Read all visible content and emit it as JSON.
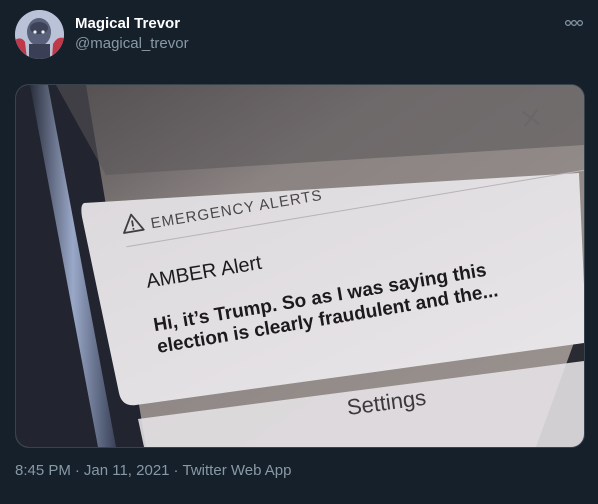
{
  "tweet": {
    "display_name": "Magical Trevor",
    "handle": "@magical_trevor",
    "time": "8:45 PM",
    "separator": "·",
    "date": "Jan 11, 2021",
    "source": "Twitter Web App"
  },
  "media": {
    "alert": {
      "header": "EMERGENCY ALERTS",
      "title": "AMBER Alert",
      "line1": "Hi, it’s Trump. So as I was saying this",
      "line2": "election is clearly fraudulent and the...",
      "settings": "Settings"
    }
  },
  "colors": {
    "background": "#15202b",
    "secondary_text": "#8899a6",
    "border": "#38444d"
  },
  "icons": {
    "more": "more-dots-icon",
    "warning": "warning-triangle-icon",
    "close": "close-x-icon"
  }
}
